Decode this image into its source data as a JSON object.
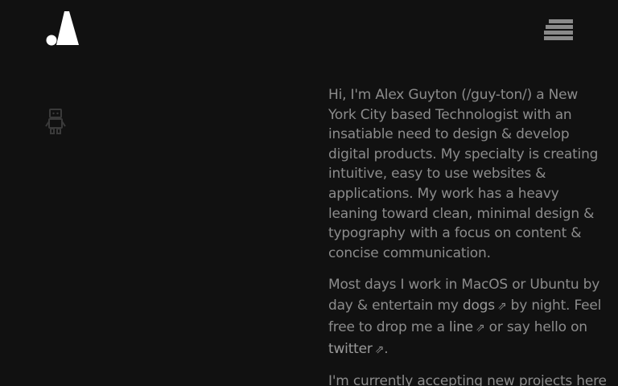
{
  "header": {
    "logo_icon": "a-logo-icon",
    "menu_icon": "hamburger-menu-icon"
  },
  "sidebar": {
    "robot_icon": "robot-icon"
  },
  "colors": {
    "background": "#111111",
    "text": "#8c8c8c",
    "logo": "#ffffff",
    "menu": "#8a8a8a"
  },
  "intro": {
    "paragraph1": "Hi, I'm Alex Guyton (/guy-ton/) a New York City based Technologist with an insatiable need to design & develop digital products. My specialty is creating intuitive, easy to use websites & applications. My work has a heavy leaning toward clean, minimal design & typography with a focus on content & concise communication.",
    "p2_before_dogs": "Most days I work in MacOS or Ubuntu by day & entertain my ",
    "dogs_link": "dogs",
    "p2_after_dogs": " by night. Feel free to drop me a ",
    "line_link": "line",
    "p2_after_line": " or say hello on ",
    "twitter_link": "twitter",
    "p2_end": ".",
    "paragraph3": "I'm currently accepting new projects here",
    "arrow_glyph": "⇗"
  }
}
